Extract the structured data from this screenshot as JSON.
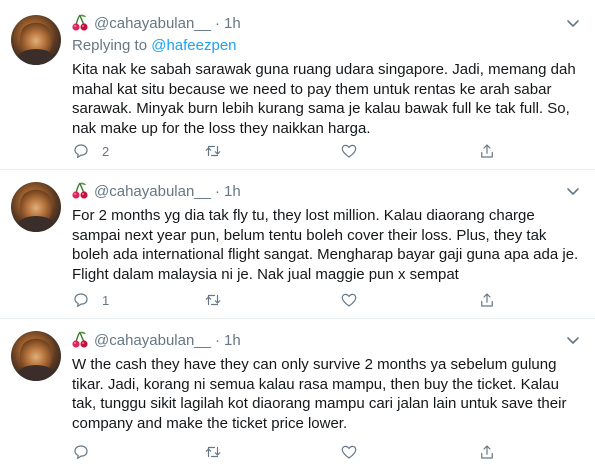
{
  "tweets": [
    {
      "username": "@cahayabulan__",
      "separator": "·",
      "time": "1h",
      "replying_label": "Replying to",
      "replying_to": "@hafeezpen",
      "text": "Kita nak ke sabah sarawak guna ruang udara singapore. Jadi, memang dah mahal kat situ because we need to pay them untuk rentas ke arah sabar sarawak. Minyak burn lebih kurang sama je kalau bawak full ke tak full. So, nak make up for the loss they naikkan harga.",
      "reply_count": "2",
      "retweet_count": "",
      "like_count": ""
    },
    {
      "username": "@cahayabulan__",
      "separator": "·",
      "time": "1h",
      "text": "For 2 months yg dia tak fly tu, they lost million. Kalau diaorang charge sampai next year pun, belum tentu boleh cover their loss. Plus, they tak boleh ada international flight sangat. Mengharap bayar gaji guna apa ada je. Flight dalam malaysia ni je. Nak jual maggie pun x sempat",
      "reply_count": "1",
      "retweet_count": "",
      "like_count": ""
    },
    {
      "username": "@cahayabulan__",
      "separator": "·",
      "time": "1h",
      "text": "W the cash they have they can only survive 2 months ya sebelum gulung tikar. Jadi, korang ni semua kalau rasa mampu, then buy the ticket. Kalau tak, tunggu sikit lagilah kot diaorang mampu cari jalan lain untuk save their company and make the ticket price lower.",
      "reply_count": "",
      "retweet_count": "",
      "like_count": ""
    }
  ],
  "colors": {
    "text": "#14171a",
    "muted": "#657786",
    "link": "#1da1f2",
    "divider": "#e6ecf0",
    "cherry": "#e0245e"
  },
  "icons": [
    "cherry-emoji-icon",
    "chevron-down-icon",
    "reply-icon",
    "retweet-icon",
    "like-icon",
    "share-icon"
  ]
}
